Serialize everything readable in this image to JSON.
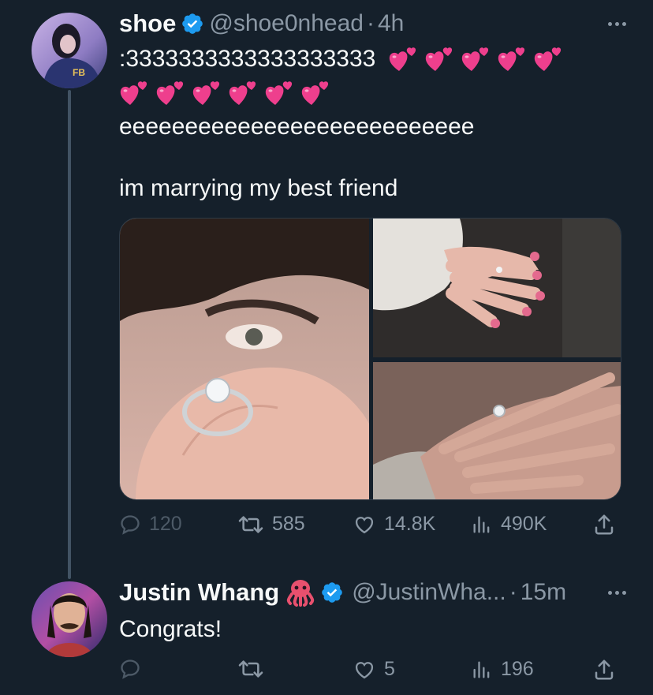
{
  "tweet": {
    "display_name": "shoe",
    "handle": "@shoe0nhead",
    "separator": "·",
    "time": "4h",
    "text_line1": ":3333333333333333333",
    "text_line3": "eeeeeeeeeeeeeeeeeeeeeeeeeee",
    "text_line4": "im marrying my best friend",
    "emoji": "revolving-hearts",
    "emoji_count": 11,
    "stats": {
      "replies": "120",
      "retweets": "585",
      "likes": "14.8K",
      "views": "490K"
    }
  },
  "reply": {
    "display_name": "Justin Whang",
    "emoji": "octopus",
    "handle": "@JustinWha...",
    "separator": "·",
    "time": "15m",
    "text": "Congrats!",
    "stats": {
      "replies": "",
      "retweets": "",
      "likes": "5",
      "views": "196"
    }
  },
  "colors": {
    "background": "#15202b",
    "verified": "#1d9bf0",
    "muted": "#8b98a5",
    "text": "#f7f9f9"
  }
}
